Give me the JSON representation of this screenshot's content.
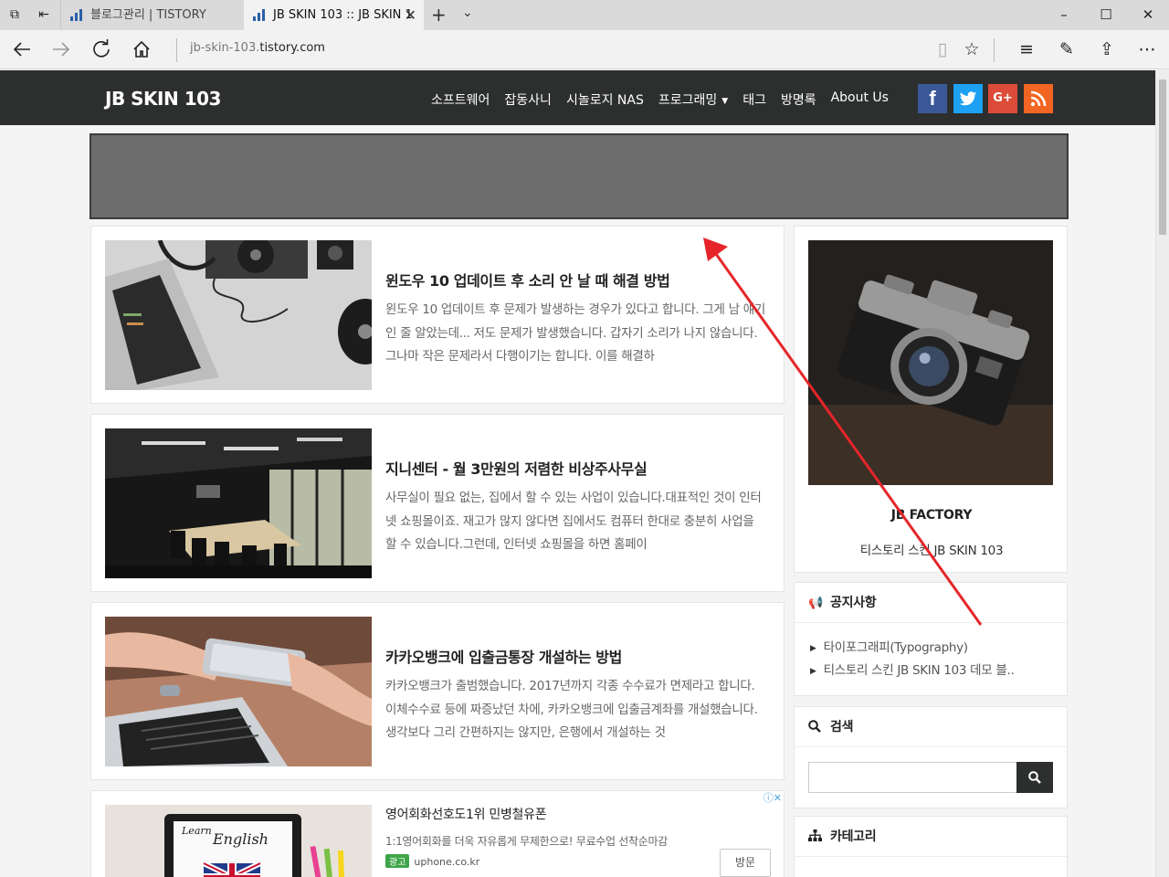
{
  "browser": {
    "tabs": [
      {
        "title": "블로그관리 | TISTORY"
      },
      {
        "title": "JB SKIN 103 :: JB SKIN 1"
      }
    ],
    "url": {
      "host_prefix": "jb-skin-103.",
      "host_domain": "tistory.com"
    },
    "icons": {
      "tab_preview": "tab-preview-icon",
      "set_aside": "set-aside-icon",
      "back": "back-arrow-icon",
      "forward": "forward-arrow-icon",
      "refresh": "refresh-icon",
      "home": "home-icon",
      "reading_view": "reading-view-icon",
      "favorite": "star-icon",
      "hub": "hub-icon",
      "notes": "pen-icon",
      "share": "share-icon",
      "more": "more-icon"
    },
    "window_controls": {
      "minimize": "–",
      "maximize": "☐",
      "close": "✕"
    }
  },
  "site": {
    "logo": "JB SKIN 103",
    "menu": [
      "소프트웨어",
      "잡동사니",
      "시놀로지 NAS",
      "프로그래밍",
      "태그",
      "방명록",
      "About Us"
    ],
    "social": [
      {
        "name": "facebook",
        "glyph": "f",
        "color": "#3b5998"
      },
      {
        "name": "twitter",
        "glyph": "t",
        "color": "#1da1f2"
      },
      {
        "name": "google-plus",
        "glyph": "G+",
        "color": "#dd4b39"
      },
      {
        "name": "rss",
        "glyph": "rss",
        "color": "#f26522"
      }
    ],
    "colors": {
      "header_bg": "#2c2f2e",
      "banner_bg": "#6d6d6d",
      "annotation_arrow": "#e5252a"
    }
  },
  "posts": [
    {
      "title": "윈도우 10 업데이트 후 소리 안 날 때 해결 방법",
      "excerpt": "윈도우 10 업데이트 후 문제가 발생하는 경우가 있다고 합니다. 그게 남 얘기인 줄 알았는데... 저도 문제가 발생했습니다. 갑자기 소리가 나지 않습니다. 그나마 작은 문제라서 다행이기는 합니다. 이를 해결하"
    },
    {
      "title": "지니센터 - 월 3만원의 저렴한 비상주사무실",
      "excerpt": "사무실이 필요 없는, 집에서 할 수 있는 사업이 있습니다.대표적인 것이 인터넷 쇼핑몰이죠. 재고가 많지 않다면 집에서도 컴퓨터 한대로 충분히 사업을 할 수 있습니다.그런데, 인터넷 쇼핑몰을 하면 홈페이"
    },
    {
      "title": "카카오뱅크에 입출금통장 개설하는 방법",
      "excerpt": "카카오뱅크가 출범했습니다. 2017년까지 각종 수수료가 면제라고 합니다. 이체수수료 등에 짜증났던 차에, 카카오뱅크에 입출금계좌를 개설했습니다. 생각보다 그리 간편하지는 않지만, 은행에서 개설하는 것"
    }
  ],
  "ad": {
    "title": "영어회화선호도1위 민병철유폰",
    "description": "1:1영어회화를 더욱 자유롭게 무제한으로! 무료수업 선착순마감",
    "tag": "광고",
    "source": "uphone.co.kr",
    "visit_label": "방문",
    "choices": "ⓘ✕",
    "image_text": {
      "learn": "Learn",
      "english": "English"
    }
  },
  "sidebar": {
    "profile": {
      "name": "JB FACTORY",
      "description": "티스토리 스킨 JB SKIN 103"
    },
    "notice": {
      "heading": "공지사항",
      "items": [
        "타이포그래피(Typography)",
        "티스토리 스킨 JB SKIN 103 데모 블.."
      ]
    },
    "search": {
      "heading": "검색",
      "placeholder": ""
    },
    "category": {
      "heading": "카테고리"
    }
  }
}
